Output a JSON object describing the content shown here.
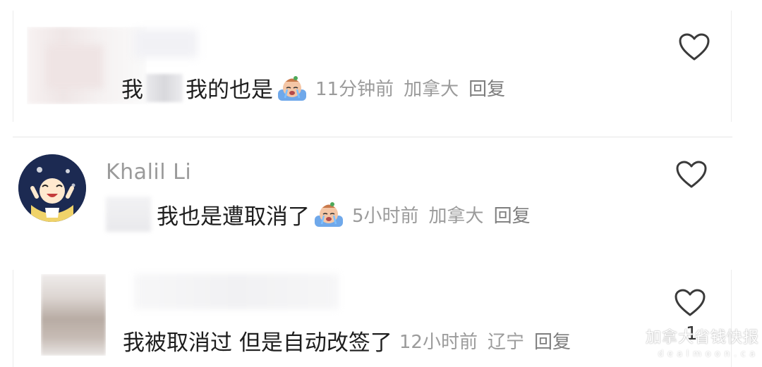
{
  "comments": [
    {
      "name": "",
      "prefix": "我",
      "text": "我的也是",
      "emoji": "crying-face-emoji",
      "time": "11分钟前",
      "location": "加拿大",
      "reply": "回复",
      "like_count": ""
    },
    {
      "name": "Khalil Li",
      "text": "我也是遭取消了",
      "emoji": "crying-face-emoji",
      "time": "5小时前",
      "location": "加拿大",
      "reply": "回复",
      "like_count": ""
    },
    {
      "name": "",
      "text": "我被取消过 但是自动改签了",
      "time": "12小时前",
      "location": "辽宁",
      "reply": "回复",
      "like_count": "1"
    }
  ],
  "watermark": {
    "title": "加拿大省钱快报",
    "subtitle": "dealmoon.ca"
  },
  "icons": {
    "like": "heart-outline-icon",
    "emoji": "crying-face-emoji"
  },
  "colors": {
    "text": "#1e1e1e",
    "meta": "#9b9b9b",
    "reply": "#7e7e7e",
    "separator": "#e6e6e6",
    "heart_outline": "#3a3a3a"
  }
}
